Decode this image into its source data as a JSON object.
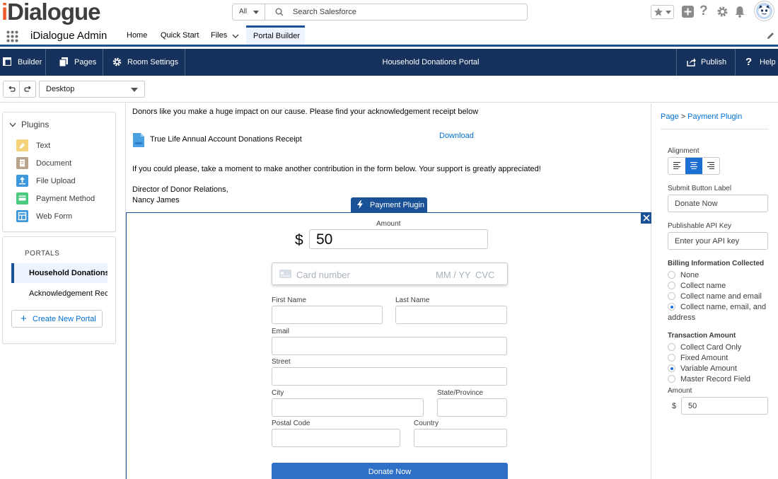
{
  "header": {
    "logo_text_i": "i",
    "logo_text_rest": "Dialogue",
    "search_scope": "All",
    "search_placeholder": "Search Salesforce"
  },
  "appnav": {
    "app_name": "iDialogue Admin",
    "tabs": [
      {
        "label": "Home"
      },
      {
        "label": "Quick Start"
      },
      {
        "label": "Files"
      },
      {
        "label": "Portal Builder",
        "active": true
      }
    ]
  },
  "builderbar": {
    "builder_label": "Builder",
    "pages_label": "Pages",
    "room_settings_label": "Room Settings",
    "title": "Household Donations Portal",
    "publish_label": "Publish",
    "help_label": "Help"
  },
  "toolbar": {
    "device": "Desktop"
  },
  "plugins": {
    "heading": "Plugins",
    "items": [
      {
        "label": "Text",
        "icon": "text-icon",
        "color": "#f4d37a"
      },
      {
        "label": "Document",
        "icon": "document-icon",
        "color": "#b8a48a"
      },
      {
        "label": "File Upload",
        "icon": "file-upload-icon",
        "color": "#3c97dd"
      },
      {
        "label": "Payment Method",
        "icon": "payment-method-icon",
        "color": "#4bca81"
      },
      {
        "label": "Web Form",
        "icon": "web-form-icon",
        "color": "#3c97dd"
      }
    ]
  },
  "portals": {
    "heading": "PORTALS",
    "items": [
      {
        "label": "Household Donations",
        "active": true
      },
      {
        "label": "Acknowledgement Receipts"
      }
    ],
    "create_label": "Create New Portal"
  },
  "canvas": {
    "intro": "Donors like you make a huge impact on our cause. Please find your acknowledgement receipt below",
    "receipt_name": "True Life Annual Account Donations Receipt",
    "download_label": "Download",
    "request": "If you could please, take a moment to make another contribution in the form below. Your support is greatly appreciated!",
    "signature_title": "Director of Donor Relations,",
    "signature_name": "Nancy James",
    "plugin_tag": "Payment Plugin"
  },
  "form": {
    "amount_label": "Amount",
    "currency": "$",
    "amount_value": "50",
    "card_placeholder": "Card number",
    "card_expiry": "MM / YY",
    "card_cvc": "CVC",
    "first_name_label": "First Name",
    "last_name_label": "Last Name",
    "email_label": "Email",
    "street_label": "Street",
    "city_label": "City",
    "state_label": "State/Province",
    "postal_label": "Postal Code",
    "country_label": "Country",
    "submit_label": "Donate Now"
  },
  "props": {
    "breadcrumb_page": "Page",
    "breadcrumb_sep": ">",
    "breadcrumb_current": "Payment Plugin",
    "alignment_label": "Alignment",
    "alignment_value": "center",
    "submit_label_label": "Submit Button Label",
    "submit_label_value": "Donate Now",
    "api_key_label": "Publishable API Key",
    "api_key_placeholder": "Enter your API key",
    "billing_label": "Billing Information Collected",
    "billing_options": [
      {
        "label": "None",
        "checked": false
      },
      {
        "label": "Collect name",
        "checked": false
      },
      {
        "label": "Collect name and email",
        "checked": false
      },
      {
        "label": "Collect name, email, and",
        "label2": "address",
        "checked": true
      }
    ],
    "transaction_label": "Transaction Amount",
    "transaction_options": [
      {
        "label": "Collect Card Only",
        "checked": false
      },
      {
        "label": "Fixed Amount",
        "checked": false
      },
      {
        "label": "Variable Amount",
        "checked": true
      },
      {
        "label": "Master Record Field",
        "checked": false
      }
    ],
    "amount_label": "Amount",
    "amount_currency": "$",
    "amount_value": "50"
  },
  "colors": {
    "brand_navy": "#16325c",
    "accent_blue": "#1b5297",
    "link_blue": "#0070d2",
    "logo_orange": "#f05a28"
  }
}
